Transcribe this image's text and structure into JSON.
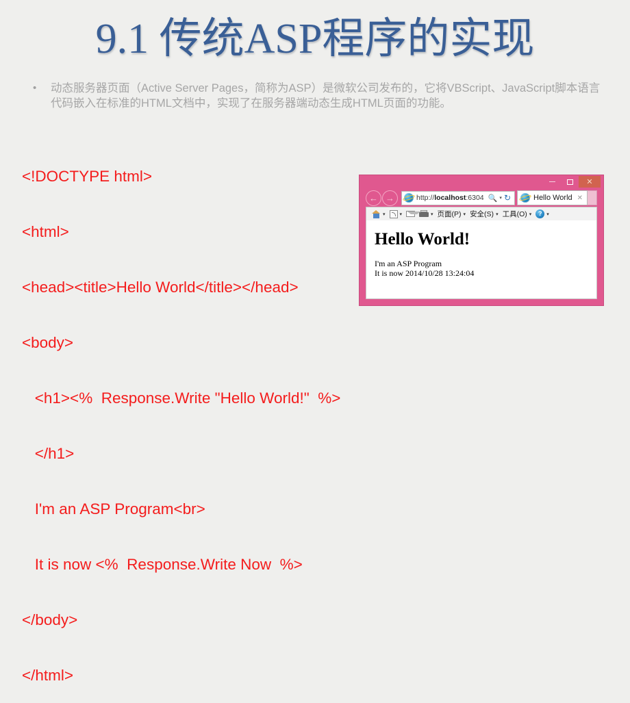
{
  "slide": {
    "title": "9.1 传统ASP程序的实现",
    "background_color": "#efefed",
    "title_color": "#3a5f96"
  },
  "bullet": {
    "marker": "•",
    "text": "动态服务器页面（Active Server Pages，简称为ASP）是微软公司发布的，它将VBScript、JavaScript脚本语言代码嵌入在标准的HTML文档中，实现了在服务器端动态生成HTML页面的功能。",
    "color": "#a6a6a6"
  },
  "code": {
    "color": "#f41c1c",
    "lines": [
      "<!DOCTYPE html>",
      "<html>",
      "<head><title>Hello World</title></head>",
      "<body>",
      "   <h1><%  Response.Write \"Hello World!\"  %>",
      "   </h1>",
      "   I'm an ASP Program<br>",
      "   It is now <%  Response.Write Now  %>",
      "</body>",
      "</html>"
    ]
  },
  "browser": {
    "theme_color": "#e0588f",
    "close_button_color": "#d1634f",
    "window_controls": {
      "minimize_label": "",
      "maximize_label": "",
      "close_label": "✕"
    },
    "nav": {
      "back_label": "←",
      "forward_label": "→"
    },
    "address": {
      "url_scheme": "http://",
      "url_host": "localhost",
      "url_port": ":6304",
      "search_icon": "search-icon",
      "caret": "▾",
      "refresh_icon": "↻"
    },
    "tab": {
      "label": "Hello World",
      "close_label": "✕",
      "favicon": "internet-explorer-icon"
    },
    "command_bar": [
      {
        "icon": "home-icon",
        "label": "",
        "caret": "▾"
      },
      {
        "icon": "rss-icon",
        "label": "",
        "caret": "▾"
      },
      {
        "icon": "mail-icon",
        "label": "",
        "caret": ""
      },
      {
        "icon": "print-icon",
        "label": "",
        "caret": "▾"
      },
      {
        "icon": "",
        "label": "页面(P)",
        "caret": "▾"
      },
      {
        "icon": "",
        "label": "安全(S)",
        "caret": "▾"
      },
      {
        "icon": "",
        "label": "工具(O)",
        "caret": "▾"
      },
      {
        "icon": "help-icon",
        "label": "",
        "caret": "▾"
      }
    ],
    "page": {
      "heading": "Hello World!",
      "line1": "I'm an ASP Program",
      "line2": "It is now 2014/10/28 13:24:04"
    }
  }
}
